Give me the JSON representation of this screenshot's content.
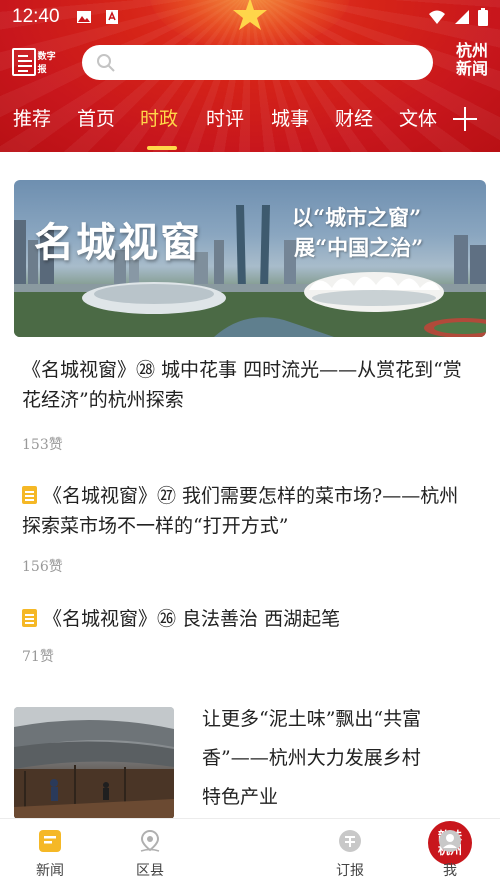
{
  "status_bar": {
    "time": "12:40"
  },
  "header": {
    "digital_paper_label": "数字报",
    "search_placeholder": "",
    "brand_line1": "杭州",
    "brand_line2": "新闻"
  },
  "tabs": [
    {
      "label": "推荐"
    },
    {
      "label": "首页"
    },
    {
      "label": "时政"
    },
    {
      "label": "时评"
    },
    {
      "label": "城事"
    },
    {
      "label": "财经"
    },
    {
      "label": "文体"
    }
  ],
  "active_tab": "时政",
  "banner": {
    "title": "名城视窗",
    "subtitle_line1": "以“城市之窗”",
    "subtitle_line2": "展“中国之治”"
  },
  "articles": [
    {
      "title": "《名城视窗》㉘ 城中花事 四时流光——从赏花到“赏花经济”的杭州探索",
      "likes": "153赞"
    },
    {
      "title": "《名城视窗》㉗ 我们需要怎样的菜市场?——杭州探索菜市场不一样的“打开方式”",
      "likes": "156赞"
    },
    {
      "title": "《名城视窗》㉖ 良法善治 西湖起笔",
      "likes": "71赞"
    },
    {
      "title": "让更多“泥土味”飘出“共富香”——杭州大力发展乡村特色产业"
    }
  ],
  "bottom_nav": {
    "news": "新闻",
    "district": "区县",
    "home_logo_line1": "韵味",
    "home_logo_line2": "杭州",
    "subscribe": "订报",
    "me": "我"
  },
  "colors": {
    "header_red": "#c8161c",
    "accent_yellow": "#ffd84a",
    "doc_icon_yellow": "#f5b826",
    "nav_active": "#f5b826"
  }
}
